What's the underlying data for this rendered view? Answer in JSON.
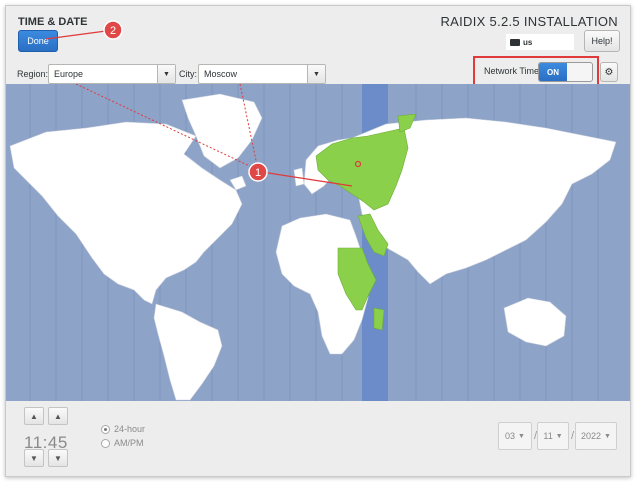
{
  "header": {
    "title": "TIME & DATE",
    "done_label": "Done",
    "installation_title": "RAIDIX 5.2.5 INSTALLATION",
    "keyboard_layout": "us",
    "help_label": "Help!"
  },
  "location": {
    "region_label": "Region:",
    "region_value": "Europe",
    "city_label": "City:",
    "city_value": "Moscow"
  },
  "network_time": {
    "label": "Network Time",
    "switch_label": "ON",
    "enabled": true
  },
  "annotations": {
    "marker_1": "1",
    "marker_2": "2"
  },
  "time": {
    "value": "11:45",
    "format_24h_label": "24-hour",
    "format_ampm_label": "AM/PM",
    "selected_format": "24-hour"
  },
  "date": {
    "month": "03",
    "day": "11",
    "year": "2022"
  },
  "icons": {
    "keyboard": "keyboard-icon",
    "gear": "gear-icon",
    "up": "chevron-up-icon",
    "down": "chevron-down-icon"
  },
  "colors": {
    "accent": "#2a6fc4",
    "ocean": "#8ea3c8",
    "timezone_band": "#6b8cc8",
    "selected_zone": "#8ad04a",
    "callout": "#e03a3a"
  }
}
